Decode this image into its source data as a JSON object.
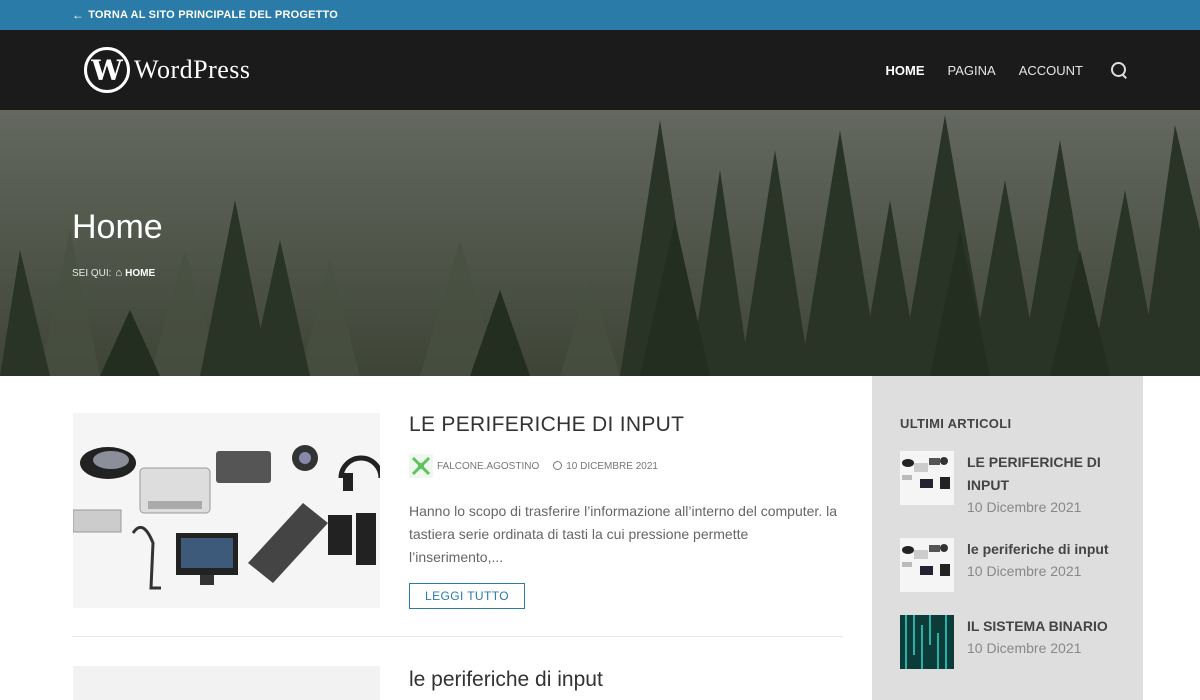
{
  "topbar": {
    "back_label": "TORNA AL SITO PRINCIPALE DEL PROGETTO"
  },
  "header": {
    "logo_text": "WordPress",
    "nav": [
      "HOME",
      "PAGINA",
      "ACCOUNT"
    ],
    "active_nav": "HOME"
  },
  "hero": {
    "title": "Home",
    "breadcrumb_prefix": "SEI QUI:",
    "breadcrumb_current": "HOME"
  },
  "posts": [
    {
      "title": "LE PERIFERICHE DI INPUT",
      "author": "FALCONE.AGOSTINO",
      "date": "10 DICEMBRE 2021",
      "excerpt": "Hanno lo scopo di trasferire l’informazione all’interno del computer. la tastiera serie ordinata di tasti la cui pressione permette l’inserimento,...",
      "button": "LEGGI TUTTO"
    },
    {
      "title": "le periferiche di input"
    }
  ],
  "sidebar": {
    "widget_title": "ULTIMI ARTICOLI",
    "recent": [
      {
        "title": "LE PERIFERICHE DI INPUT",
        "date": "10 Dicembre 2021"
      },
      {
        "title": "le periferiche di input",
        "date": "10 Dicembre 2021"
      },
      {
        "title": "IL SISTEMA BINARIO",
        "date": "10 Dicembre 2021"
      }
    ]
  },
  "colors": {
    "topbar": "#2a7ba8",
    "header": "#1b1b1b",
    "accent": "#2a7ba8",
    "sidebar": "#dedede"
  },
  "icons": [
    "arrow-left-icon",
    "wordpress-logo-icon",
    "search-icon",
    "home-icon",
    "clock-icon"
  ]
}
